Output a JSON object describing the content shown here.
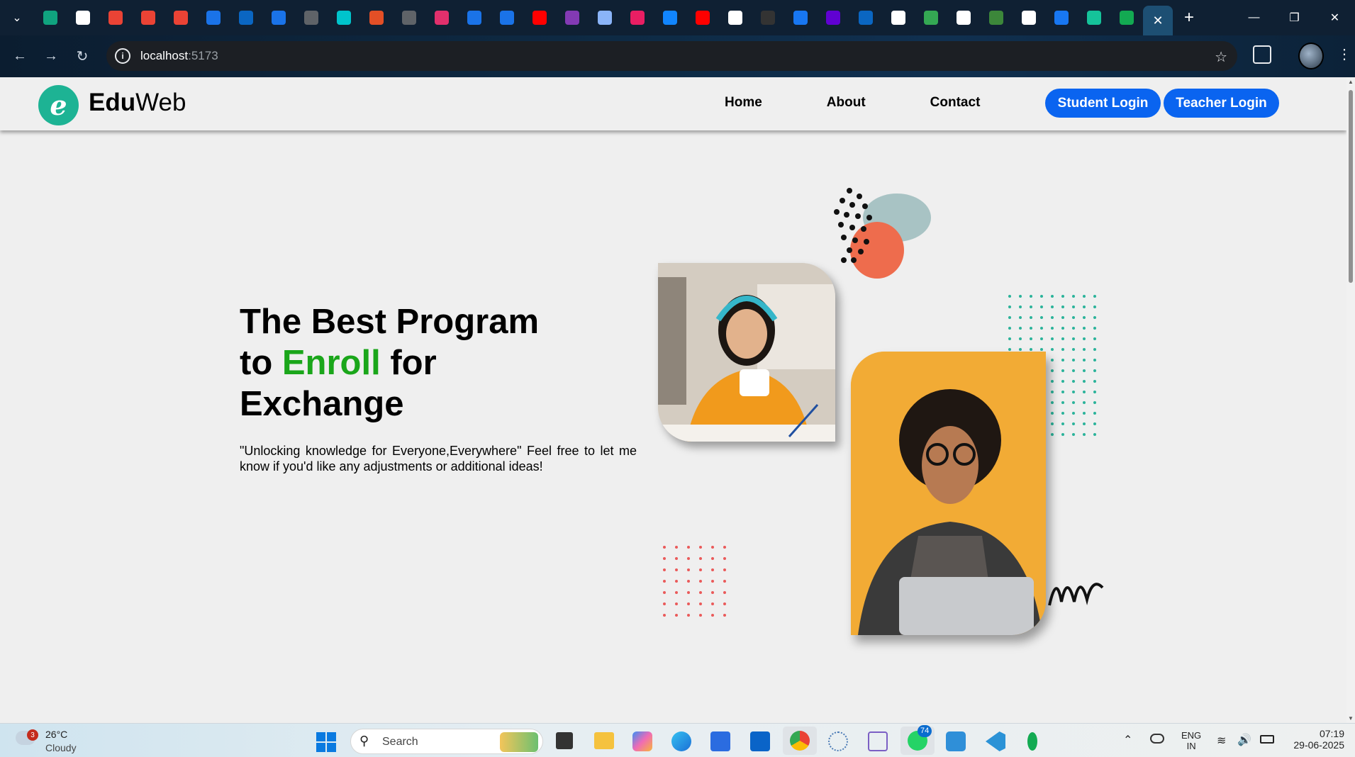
{
  "browser": {
    "active_tab_close": "✕",
    "new_tab": "+",
    "url_host": "localhost",
    "url_port": ":5173",
    "tabs": [
      {
        "icon": "chatgpt-icon",
        "color": "#10a37f"
      },
      {
        "icon": "pause-app-icon",
        "color": "#ffffff"
      },
      {
        "icon": "gmail-icon",
        "color": "#ea4335"
      },
      {
        "icon": "gmail-icon",
        "color": "#ea4335"
      },
      {
        "icon": "gmail-icon",
        "color": "#ea4335"
      },
      {
        "icon": "vector-icon",
        "color": "#1a73e8"
      },
      {
        "icon": "linkedin-icon",
        "color": "#0a66c2"
      },
      {
        "icon": "vector-icon",
        "color": "#1a73e8"
      },
      {
        "icon": "globe-icon",
        "color": "#5f6368"
      },
      {
        "icon": "canva-icon",
        "color": "#00c4cc"
      },
      {
        "icon": "dots-icon",
        "color": "#e34f26"
      },
      {
        "icon": "globe-icon",
        "color": "#5f6368"
      },
      {
        "icon": "instagram-icon",
        "color": "#e1306c"
      },
      {
        "icon": "vector-icon",
        "color": "#1a73e8"
      },
      {
        "icon": "vector-icon",
        "color": "#1a73e8"
      },
      {
        "icon": "youtube-icon",
        "color": "#ff0000"
      },
      {
        "icon": "app-icon",
        "color": "#833ab4"
      },
      {
        "icon": "gemini-icon",
        "color": "#8ab4f8"
      },
      {
        "icon": "circle-app-icon",
        "color": "#e91e63"
      },
      {
        "icon": "butterfly-icon",
        "color": "#1185fe"
      },
      {
        "icon": "youtube-icon",
        "color": "#ff0000"
      },
      {
        "icon": "google-icon",
        "color": "#ffffff"
      },
      {
        "icon": "github-icon",
        "color": "#333333"
      },
      {
        "icon": "facebook-icon",
        "color": "#1877f2"
      },
      {
        "icon": "mail-icon",
        "color": "#6001d2"
      },
      {
        "icon": "linkedin-icon",
        "color": "#0a66c2"
      },
      {
        "icon": "google-icon",
        "color": "#ffffff"
      },
      {
        "icon": "drive-icon",
        "color": "#34a853"
      },
      {
        "icon": "openai-icon",
        "color": "#ffffff"
      },
      {
        "icon": "nodejs-icon",
        "color": "#3c873a"
      },
      {
        "icon": "google-icon",
        "color": "#ffffff"
      },
      {
        "icon": "facebook-icon",
        "color": "#1877f2"
      },
      {
        "icon": "grammarly-icon",
        "color": "#15c39a"
      },
      {
        "icon": "mongodb-icon",
        "color": "#13aa52"
      }
    ]
  },
  "site": {
    "logo_bold": "Edu",
    "logo_rest": "Web",
    "logo_letter": "e",
    "nav": {
      "home": "Home",
      "about": "About",
      "contact": "Contact"
    },
    "student_login": "Student Login",
    "teacher_login": "Teacher Login",
    "hero": {
      "title_line1": "The Best Program",
      "title_to": "to ",
      "title_enroll": "Enroll",
      "title_for": " for",
      "title_line3": "Exchange",
      "text": "\"Unlocking knowledge for Everyone,Everywhere\" Feel free to let me know if you'd like any adjustments or additional ideas!"
    },
    "colors": {
      "accent": "#1aa61a",
      "button": "#0a64f0",
      "logo": "#1db394",
      "blob_orange": "#ee6c4d",
      "blob_teal": "#a8c3c4"
    }
  },
  "taskbar": {
    "weather_temp": "26°C",
    "weather_desc": "Cloudy",
    "weather_badge": "3",
    "search_placeholder": "Search",
    "whatsapp_badge": "74",
    "lang_top": "ENG",
    "lang_bottom": "IN",
    "time": "07:19",
    "date": "29-06-2025"
  }
}
